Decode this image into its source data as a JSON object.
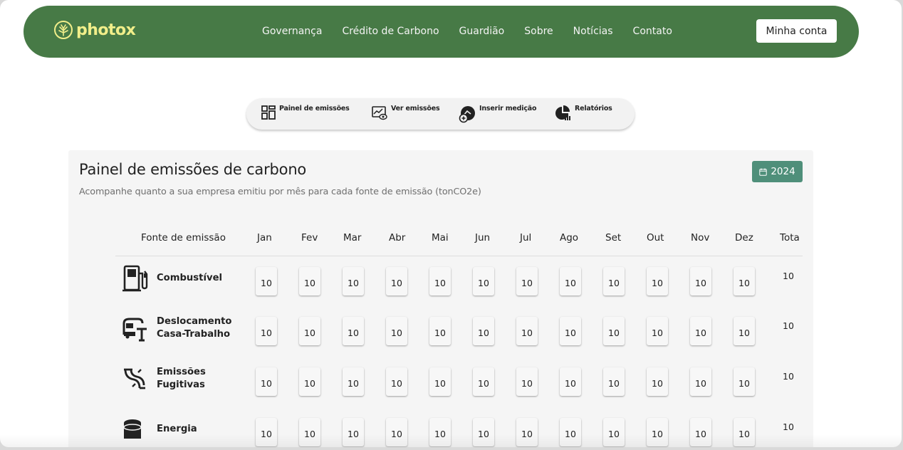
{
  "brand": {
    "name": "photox",
    "logo_color": "#f1ee8a",
    "nav_color": "#477a46"
  },
  "nav": {
    "items": [
      "Governança",
      "Crédito de Carbono",
      "Guardião",
      "Sobre",
      "Notícias",
      "Contato"
    ],
    "account_label": "Minha conta"
  },
  "toolbar": {
    "items": [
      {
        "label": "Painel de emissões",
        "icon": "dashboard-grid-icon"
      },
      {
        "label": "Ver emissões",
        "icon": "chart-eye-icon"
      },
      {
        "label": "Inserir medição",
        "icon": "gauge-plus-icon"
      },
      {
        "label": "Relatórios",
        "icon": "pie-report-icon"
      }
    ]
  },
  "panel": {
    "title": "Painel de emissões de carbono",
    "subtitle": "Acompanhe quanto a sua empresa emitiu por mês para cada fonte de emissão (tonCO2e)",
    "year": "2024",
    "year_icon": "calendar-icon",
    "accent_color": "#4f8f7a"
  },
  "table": {
    "source_header": "Fonte de emissão",
    "months": [
      "Jan",
      "Fev",
      "Mar",
      "Abr",
      "Mai",
      "Jun",
      "Jul",
      "Ago",
      "Set",
      "Out",
      "Nov",
      "Dez"
    ],
    "total_header": "Tota",
    "rows": [
      {
        "source": "Combustível",
        "icon": "fuel-pump-icon",
        "values": [
          "10",
          "10",
          "10",
          "10",
          "10",
          "10",
          "10",
          "10",
          "10",
          "10",
          "10",
          "10"
        ],
        "total": "10"
      },
      {
        "source": "Deslocamento Casa-Trabalho",
        "icon": "bus-stop-icon",
        "values": [
          "10",
          "10",
          "10",
          "10",
          "10",
          "10",
          "10",
          "10",
          "10",
          "10",
          "10",
          "10"
        ],
        "total": "10"
      },
      {
        "source": "Emissões Fugitivas",
        "icon": "pipe-leak-icon",
        "values": [
          "10",
          "10",
          "10",
          "10",
          "10",
          "10",
          "10",
          "10",
          "10",
          "10",
          "10",
          "10"
        ],
        "total": "10"
      },
      {
        "source": "Energia",
        "icon": "energy-tank-icon",
        "values": [
          "10",
          "10",
          "10",
          "10",
          "10",
          "10",
          "10",
          "10",
          "10",
          "10",
          "10",
          "10"
        ],
        "total": "10"
      }
    ]
  }
}
